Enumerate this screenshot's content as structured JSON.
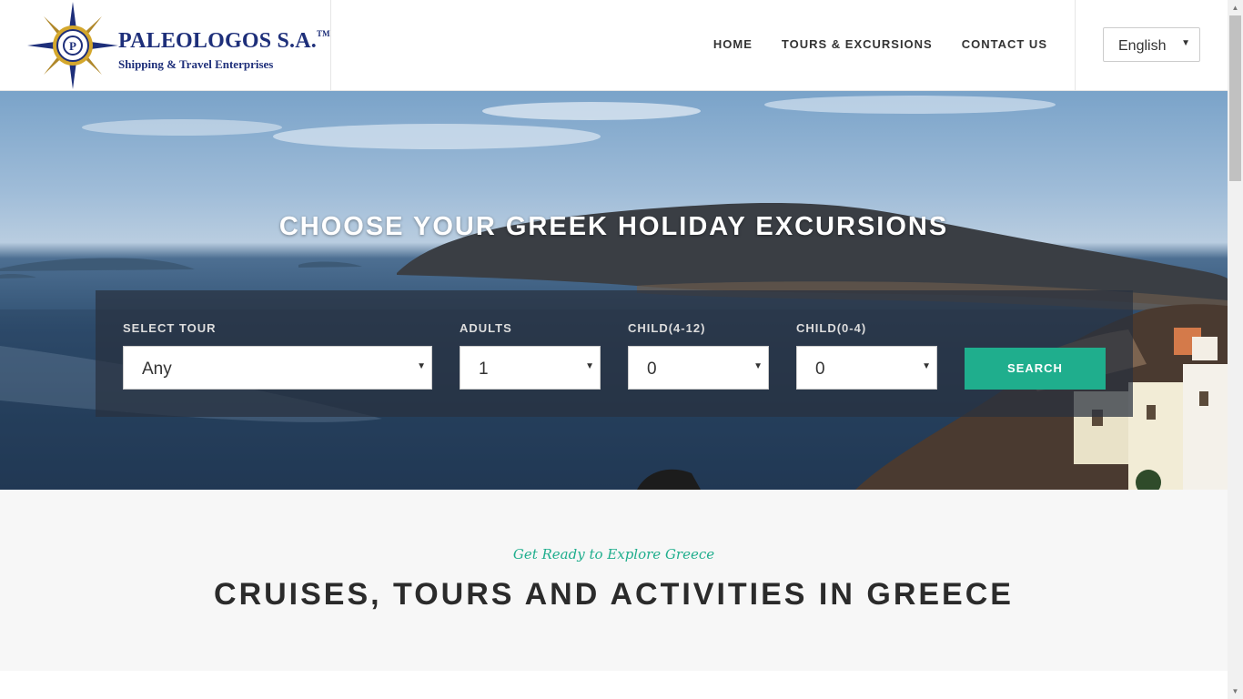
{
  "header": {
    "logo_name": "PALEOLOGOS S.A.",
    "logo_tm": "TM",
    "logo_tagline": "Shipping & Travel Enterprises",
    "logo_letter": "P",
    "nav": [
      {
        "label": "HOME"
      },
      {
        "label": "TOURS & EXCURSIONS"
      },
      {
        "label": "CONTACT US"
      }
    ],
    "language": "English"
  },
  "hero": {
    "title": "CHOOSE YOUR GREEK HOLIDAY EXCURSIONS",
    "search": {
      "tour_label": "SELECT TOUR",
      "tour_value": "Any",
      "adults_label": "ADULTS",
      "adults_value": "1",
      "child_4_12_label": "CHILD(4-12)",
      "child_4_12_value": "0",
      "child_0_4_label": "CHILD(0-4)",
      "child_0_4_value": "0",
      "button_label": "SEARCH"
    }
  },
  "intro": {
    "subtitle": "Get Ready to Explore Greece",
    "title": "CRUISES, TOURS AND ACTIVITIES IN GREECE"
  },
  "colors": {
    "accent": "#1fae8d",
    "logo_blue": "#1e2f7a",
    "logo_gold": "#d4a72c"
  },
  "icons": {
    "dropdown": "chevron-down-icon",
    "logo": "compass-icon"
  }
}
